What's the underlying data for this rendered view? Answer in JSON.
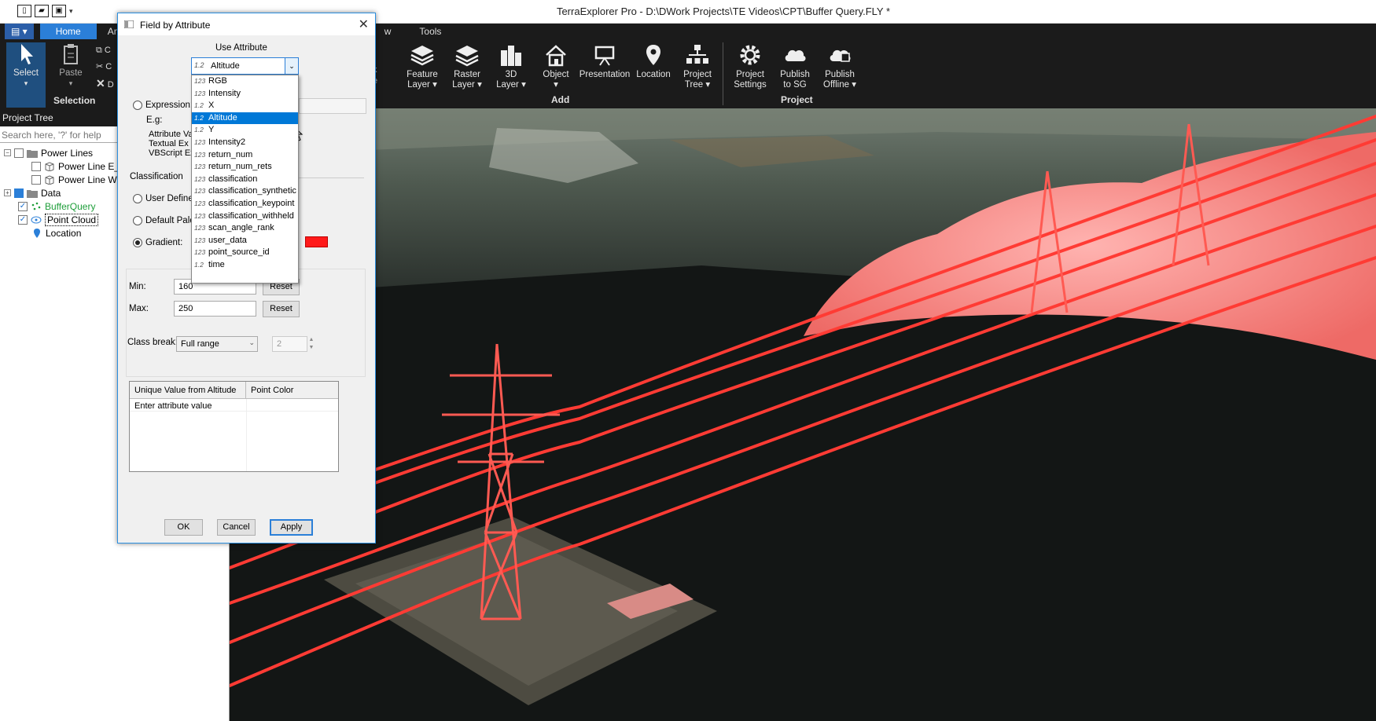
{
  "window": {
    "title": "TerraExplorer Pro - D:\\DWork Projects\\TE Videos\\CPT\\Buffer Query.FLY *"
  },
  "ribbon": {
    "tabs": [
      "Home",
      "Anal",
      "w",
      "Tools"
    ],
    "select": "Select",
    "paste": "Paste",
    "small_labels": [
      "C",
      "C",
      "D"
    ],
    "groups": {
      "selection": "Selection",
      "add": "Add",
      "project": "Project"
    },
    "buttons": [
      {
        "label": "Feature\nLayer ▾",
        "icon": "layers-icon"
      },
      {
        "label": "Raster\nLayer ▾",
        "icon": "raster-layer-icon"
      },
      {
        "label": "3D\nLayer ▾",
        "icon": "buildings-icon"
      },
      {
        "label": "Object\n▾",
        "icon": "house-icon"
      },
      {
        "label": "Presentation",
        "icon": "presentation-icon"
      },
      {
        "label": "Location",
        "icon": "location-pin-icon"
      },
      {
        "label": "Project\nTree ▾",
        "icon": "tree-icon"
      },
      {
        "label": "Project\nSettings",
        "icon": "gear-icon"
      },
      {
        "label": "Publish\nto SG",
        "icon": "cloud-publish-icon"
      },
      {
        "label": "Publish\nOffline ▾",
        "icon": "offline-publish-icon"
      }
    ],
    "partial_k": "k",
    "partial_e": "e"
  },
  "project_tree": {
    "header": "Project Tree",
    "search_placeholder": "Search here, '?' for help",
    "items": [
      {
        "label": "Power Lines",
        "color": "#000000"
      },
      {
        "label": "Power Line E_",
        "color": "#000000"
      },
      {
        "label": "Power Line W",
        "color": "#000000"
      },
      {
        "label": "Data",
        "color": "#000000"
      },
      {
        "label": "BufferQuery",
        "color": "#1e9e3a"
      },
      {
        "label": "Point Cloud",
        "color": "#000000"
      },
      {
        "label": "Location",
        "color": "#000000"
      }
    ]
  },
  "dialog": {
    "title": "Field by Attribute",
    "use_attribute_label": "Use Attribute",
    "selected_attribute": "Altitude",
    "selected_type": "1.2",
    "options": [
      {
        "type": "123",
        "name": "RGB"
      },
      {
        "type": "123",
        "name": "Intensity"
      },
      {
        "type": "1.2",
        "name": "X"
      },
      {
        "type": "1.2",
        "name": "Altitude",
        "selected": true
      },
      {
        "type": "1.2",
        "name": "Y"
      },
      {
        "type": "123",
        "name": "Intensity2"
      },
      {
        "type": "123",
        "name": "return_num"
      },
      {
        "type": "123",
        "name": "return_num_rets"
      },
      {
        "type": "123",
        "name": "classification"
      },
      {
        "type": "123",
        "name": "classification_synthetic"
      },
      {
        "type": "123",
        "name": "classification_keypoint"
      },
      {
        "type": "123",
        "name": "classification_withheld"
      },
      {
        "type": "123",
        "name": "scan_angle_rank"
      },
      {
        "type": "123",
        "name": "user_data"
      },
      {
        "type": "123",
        "name": "point_source_id"
      },
      {
        "type": "1.2",
        "name": "time"
      }
    ],
    "expression_label": "Expression:",
    "eg_label": "E.g:",
    "eg_lines": [
      "Attribute Va",
      "Textual Ex",
      "VBScript Ex"
    ],
    "classification_label": "Classification",
    "user_defined_label": "User Defined",
    "default_palette_label": "Default Palet",
    "gradient_label": "Gradient:",
    "gradient_color": "#ff1a1a",
    "min_label": "Min:",
    "min_value": "160",
    "max_label": "Max:",
    "max_value": "250",
    "reset_label": "Reset",
    "class_break_label": "Class break:",
    "class_break_value": "Full range",
    "class_break_count": "2",
    "table_headers": [
      "Unique Value from Altitude",
      "Point Color"
    ],
    "table_placeholder_row": "Enter attribute value",
    "ok_label": "OK",
    "cancel_label": "Cancel",
    "apply_label": "Apply"
  },
  "colors": {
    "accent": "#2b7fd8",
    "pointcloud": "#ff4a4a",
    "ribbon_bg": "#1b1b1b"
  }
}
